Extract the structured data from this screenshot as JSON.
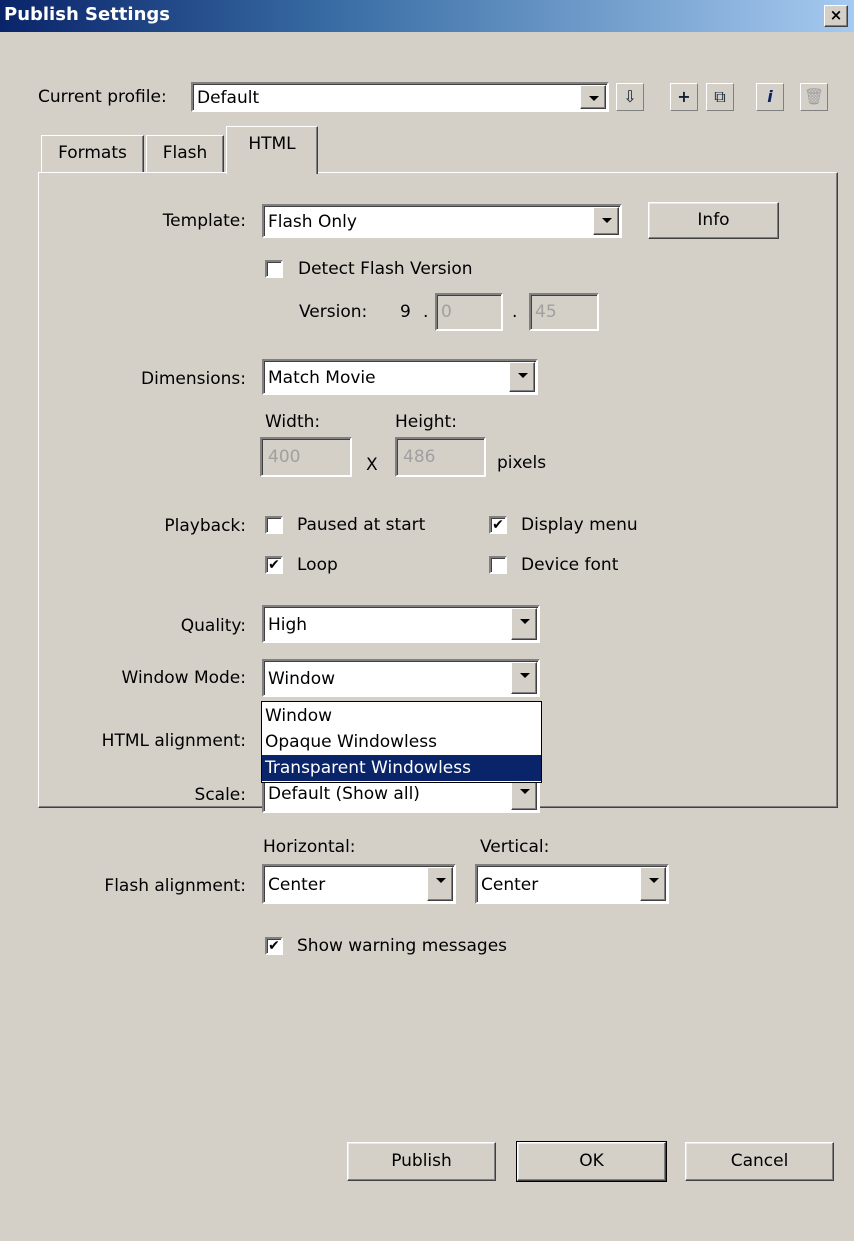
{
  "window": {
    "title": "Publish Settings",
    "close_glyph": "×"
  },
  "profile": {
    "label": "Current profile:",
    "value": "Default",
    "toolbar_icons": [
      "import-export-icon",
      "add-profile-icon",
      "duplicate-profile-icon",
      "profile-properties-icon",
      "delete-profile-icon"
    ]
  },
  "tabs": [
    {
      "label": "Formats",
      "active": false
    },
    {
      "label": "Flash",
      "active": false
    },
    {
      "label": "HTML",
      "active": true
    }
  ],
  "template": {
    "label": "Template:",
    "value": "Flash Only",
    "info_button": "Info",
    "detect_label": "Detect Flash Version",
    "detect_checked": false,
    "version_label": "Version:",
    "version_major": "9",
    "dot": ".",
    "version_minor": "0",
    "version_revision": "45"
  },
  "dimensions": {
    "label": "Dimensions:",
    "value": "Match Movie",
    "width_label": "Width:",
    "height_label": "Height:",
    "width_value": "400",
    "height_value": "486",
    "x_sep": "X",
    "unit": "pixels"
  },
  "playback": {
    "label": "Playback:",
    "paused": {
      "label": "Paused at start",
      "checked": false
    },
    "display_menu": {
      "label": "Display menu",
      "checked": true
    },
    "loop": {
      "label": "Loop",
      "checked": true
    },
    "device_font": {
      "label": "Device font",
      "checked": false
    }
  },
  "quality": {
    "label": "Quality:",
    "value": "High"
  },
  "window_mode": {
    "label": "Window Mode:",
    "value": "Window",
    "options": [
      "Window",
      "Opaque Windowless",
      "Transparent Windowless"
    ],
    "highlighted_index": 2
  },
  "html_alignment": {
    "label": "HTML alignment:"
  },
  "scale": {
    "label": "Scale:",
    "value": "Default (Show all)"
  },
  "flash_alignment": {
    "label": "Flash alignment:",
    "horizontal_label": "Horizontal:",
    "vertical_label": "Vertical:",
    "horizontal_value": "Center",
    "vertical_value": "Center"
  },
  "warnings": {
    "label": "Show warning messages",
    "checked": true
  },
  "buttons": {
    "publish": "Publish",
    "ok": "OK",
    "cancel": "Cancel"
  },
  "check_glyph": "✔"
}
